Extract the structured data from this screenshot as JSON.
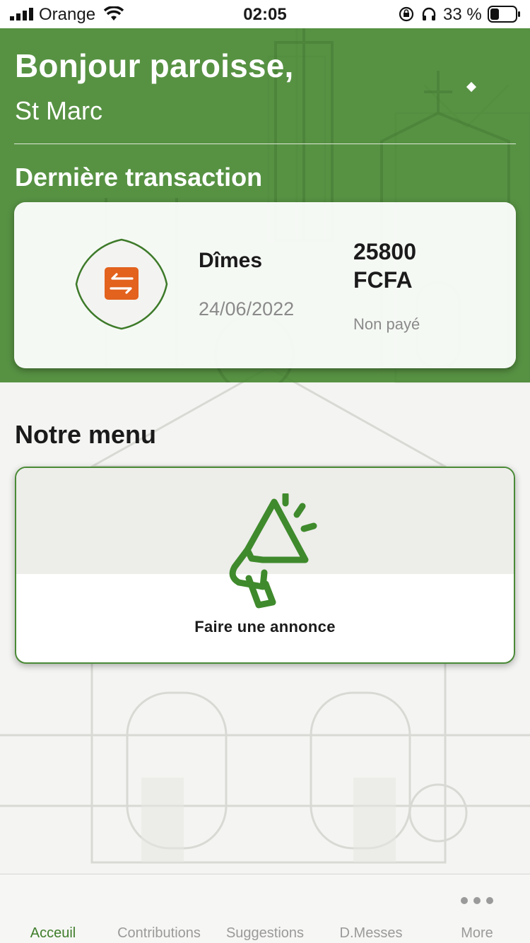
{
  "status_bar": {
    "carrier": "Orange",
    "time": "02:05",
    "battery": "33 %",
    "icons": [
      "signal-icon",
      "wifi-icon",
      "orientation-lock-icon",
      "headphones-icon",
      "battery-icon"
    ]
  },
  "header": {
    "greeting": "Bonjour paroisse,",
    "parish_name": "St Marc",
    "last_transaction_title": "Dernière transaction"
  },
  "transaction": {
    "type": "Dîmes",
    "date": "24/06/2022",
    "amount_value": "25800",
    "currency": "FCFA",
    "status": "Non payé",
    "icon": "transfer-arrows-icon"
  },
  "menu": {
    "title": "Notre menu",
    "items": [
      {
        "label": "Faire une annonce",
        "icon": "megaphone-icon"
      }
    ]
  },
  "tab_bar": {
    "active_tab": "Acceuil",
    "tabs": [
      {
        "label": "Acceuil"
      },
      {
        "label": "Contributions"
      },
      {
        "label": "Suggestions"
      },
      {
        "label": "D.Messes"
      },
      {
        "label": "More",
        "icon": "more-dots-icon"
      }
    ]
  },
  "colors": {
    "brand_green": "#468730",
    "accent_orange": "#e2621e",
    "muted_text": "#8a8a8a"
  }
}
